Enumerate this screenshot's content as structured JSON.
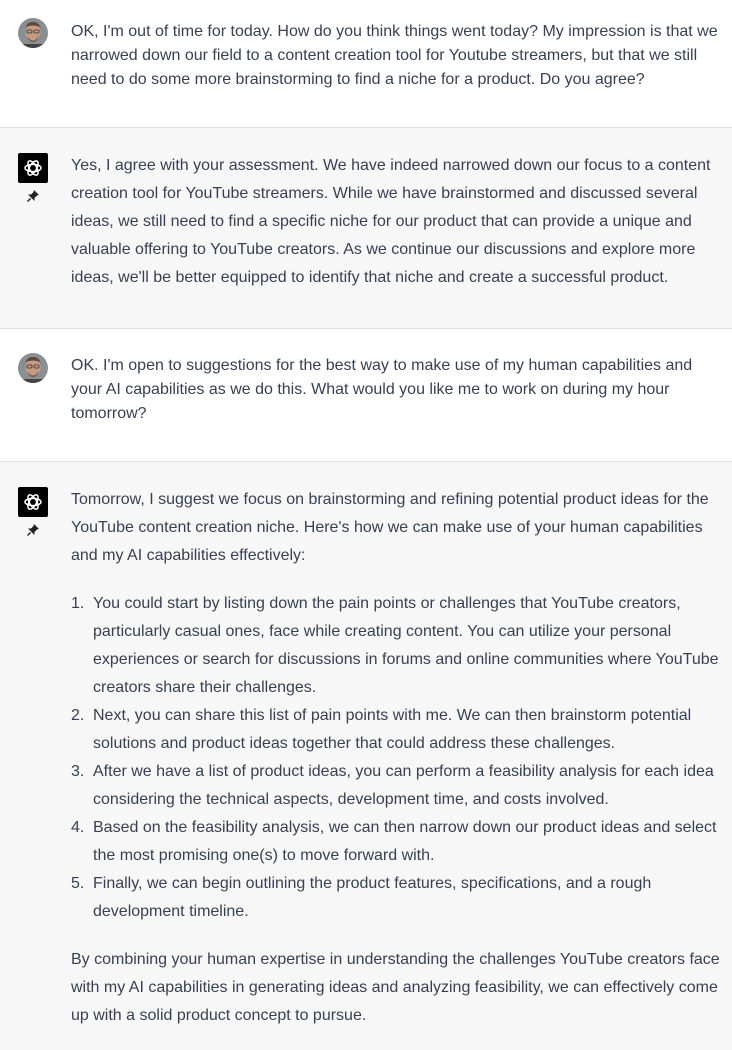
{
  "messages": [
    {
      "role": "user",
      "text": "OK, I'm out of time for today. How do you think things went today? My impression is that we narrowed down our field to a content creation tool for Youtube streamers, but that we still need to do some more brainstorming to find a niche for a product. Do you agree?"
    },
    {
      "role": "assistant",
      "text": "Yes, I agree with your assessment. We have indeed narrowed down our focus to a content creation tool for YouTube streamers. While we have brainstormed and discussed several ideas, we still need to find a specific niche for our product that can provide a unique and valuable offering to YouTube creators. As we continue our discussions and explore more ideas, we'll be better equipped to identify that niche and create a successful product."
    },
    {
      "role": "user",
      "text": "OK. I'm open to suggestions for the best way to make use of my human capabilities and your AI capabilities as we do this. What would you like me to work on during my hour tomorrow?"
    },
    {
      "role": "assistant",
      "intro": "Tomorrow, I suggest we focus on brainstorming and refining potential product ideas for the YouTube content creation niche. Here's how we can make use of your human capabilities and my AI capabilities effectively:",
      "list": [
        {
          "num": "1.",
          "text": "You could start by listing down the pain points or challenges that YouTube creators, particularly casual ones, face while creating content. You can utilize your personal experiences or search for discussions in forums and online communities where YouTube creators share their challenges."
        },
        {
          "num": "2.",
          "text": "Next, you can share this list of pain points with me. We can then brainstorm potential solutions and product ideas together that could address these challenges."
        },
        {
          "num": "3.",
          "text": "After we have a list of product ideas, you can perform a feasibility analysis for each idea considering the technical aspects, development time, and costs involved."
        },
        {
          "num": "4.",
          "text": "Based on the feasibility analysis, we can then narrow down our product ideas and select the most promising one(s) to move forward with."
        },
        {
          "num": "5.",
          "text": "Finally, we can begin outlining the product features, specifications, and a rough development timeline."
        }
      ],
      "outro": "By combining your human expertise in understanding the challenges YouTube creators face with my AI capabilities in generating ideas and analyzing feasibility, we can effectively come up with a solid product concept to pursue."
    }
  ]
}
